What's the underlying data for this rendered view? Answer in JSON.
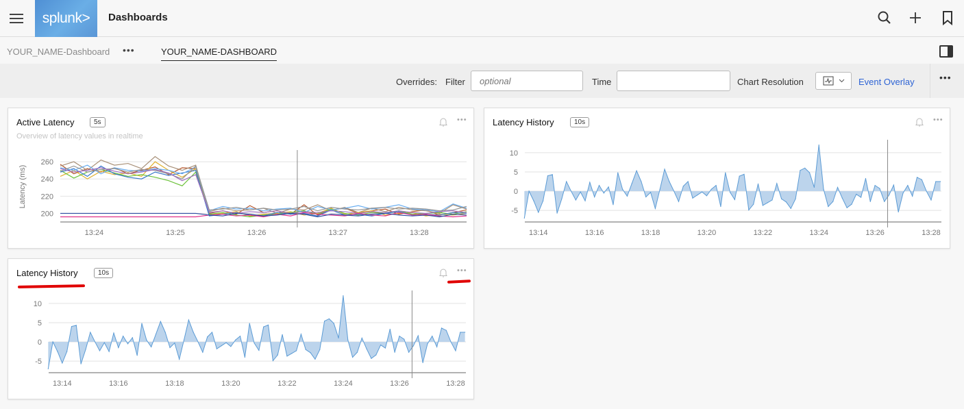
{
  "header": {
    "hamburger_icon": "menu-icon",
    "logo_text": "splunk>",
    "title": "Dashboards",
    "icons": [
      "search-icon",
      "plus-icon",
      "bookmark-icon"
    ]
  },
  "tabs": {
    "group_name": "YOUR_NAME-Dashboard",
    "more_label": "•••",
    "active_tab": "YOUR_NAME-DASHBOARD"
  },
  "toolbar": {
    "overrides_label": "Overrides:",
    "filter_label": "Filter",
    "filter_placeholder": "optional",
    "filter_value": "",
    "time_label": "Time",
    "time_value": "",
    "chart_resolution_label": "Chart Resolution",
    "event_overlay_label": "Event Overlay",
    "more_label": "•••",
    "accent_color": "#2d63d4"
  },
  "panels": [
    {
      "title": "Active Latency",
      "badge": "5s",
      "subtitle": "Overview of latency values in realtime",
      "more_label": "•••"
    },
    {
      "title": "Latency History",
      "badge": "10s",
      "more_label": "•••"
    },
    {
      "title": "Latency History",
      "badge": "10s",
      "more_label": "•••"
    }
  ],
  "chart_data": [
    {
      "type": "line",
      "ylabel": "Latency (ms)",
      "yticks": [
        200,
        220,
        240,
        260
      ],
      "ylim": [
        190,
        272
      ],
      "xticks": [
        "13:24",
        "13:25",
        "13:26",
        "13:27",
        "13:28"
      ],
      "xlim": [
        "13:23:35",
        "13:28:35"
      ],
      "cursor_time": "13:26:30",
      "grid": true,
      "x": [
        "13:23:35",
        "13:23:45",
        "13:23:55",
        "13:24:05",
        "13:24:15",
        "13:24:25",
        "13:24:35",
        "13:24:45",
        "13:24:55",
        "13:25:05",
        "13:25:15",
        "13:25:25",
        "13:25:35",
        "13:25:45",
        "13:25:55",
        "13:26:05",
        "13:26:15",
        "13:26:25",
        "13:26:35",
        "13:26:45",
        "13:26:55",
        "13:27:05",
        "13:27:15",
        "13:27:25",
        "13:27:35",
        "13:27:45",
        "13:27:55",
        "13:28:05",
        "13:28:15",
        "13:28:25",
        "13:28:35"
      ],
      "series": [
        {
          "color": "#b5542a",
          "values": [
            257,
            246,
            252,
            248,
            253,
            246,
            250,
            254,
            245,
            253,
            252,
            200,
            203,
            199,
            209,
            201,
            203,
            199,
            210,
            198,
            204,
            206,
            200,
            203,
            205,
            199,
            202,
            204,
            198,
            201,
            204
          ]
        },
        {
          "color": "#a89078",
          "values": [
            255,
            260,
            250,
            262,
            256,
            258,
            252,
            266,
            255,
            250,
            256,
            202,
            206,
            203,
            204,
            206,
            200,
            205,
            204,
            210,
            203,
            207,
            201,
            206,
            202,
            207,
            204,
            203,
            200,
            210,
            205
          ]
        },
        {
          "color": "#e0b030",
          "values": [
            243,
            250,
            240,
            249,
            245,
            247,
            243,
            260,
            250,
            242,
            252,
            198,
            200,
            202,
            197,
            199,
            200,
            202,
            198,
            200,
            206,
            199,
            201,
            203,
            198,
            200,
            201,
            197,
            199,
            198,
            200
          ]
        },
        {
          "color": "#6cc23a",
          "values": [
            250,
            241,
            248,
            251,
            247,
            243,
            245,
            242,
            238,
            232,
            248,
            199,
            201,
            198,
            196,
            198,
            199,
            201,
            203,
            199,
            205,
            200,
            198,
            201,
            200,
            203,
            199,
            200,
            201,
            199,
            202
          ]
        },
        {
          "color": "#3a78c8",
          "values": [
            248,
            252,
            243,
            255,
            246,
            242,
            240,
            248,
            244,
            247,
            250,
            197,
            199,
            201,
            198,
            197,
            201,
            199,
            200,
            197,
            204,
            198,
            199,
            197,
            200,
            202,
            198,
            199,
            198,
            201,
            200
          ]
        },
        {
          "color": "#6aaef0",
          "values": [
            253,
            250,
            256,
            246,
            253,
            250,
            249,
            252,
            250,
            246,
            254,
            203,
            208,
            205,
            206,
            203,
            205,
            206,
            201,
            208,
            204,
            206,
            209,
            205,
            207,
            210,
            205,
            204,
            202,
            211,
            206
          ]
        },
        {
          "color": "#939393",
          "values": [
            249,
            255,
            248,
            251,
            252,
            248,
            251,
            250,
            246,
            240,
            255,
            204,
            205,
            207,
            204,
            206,
            204,
            205,
            208,
            203,
            207,
            205,
            204,
            206,
            207,
            205,
            206,
            205,
            203,
            204,
            208
          ]
        },
        {
          "color": "#a070c0",
          "values": [
            252,
            248,
            250,
            253,
            249,
            246,
            248,
            251,
            247,
            238,
            245,
            201,
            203,
            200,
            202,
            201,
            203,
            200,
            202,
            201,
            203,
            202,
            200,
            202,
            201,
            203,
            201,
            200,
            202,
            203,
            201
          ]
        },
        {
          "color": "#e0308a",
          "values": [
            196,
            196,
            196,
            196,
            196,
            196,
            196,
            196,
            196,
            196,
            196,
            198,
            199,
            197,
            198,
            196,
            199,
            197,
            201,
            199,
            198,
            197,
            200,
            198,
            197,
            201,
            198,
            199,
            197,
            196,
            197
          ]
        },
        {
          "color": "#2c4aa0",
          "values": [
            200,
            200,
            200,
            200,
            200,
            200,
            200,
            200,
            200,
            200,
            200,
            198,
            197,
            200,
            199,
            197,
            198,
            200,
            199,
            196,
            199,
            198,
            197,
            199,
            200,
            198,
            197,
            198,
            196,
            199,
            198
          ]
        }
      ]
    },
    {
      "type": "area",
      "yticks": [
        -5,
        0,
        5,
        10
      ],
      "ylim": [
        -8,
        13
      ],
      "xticks": [
        "13:14",
        "13:16",
        "13:18",
        "13:20",
        "13:22",
        "13:24",
        "13:26",
        "13:28"
      ],
      "xlim": [
        "13:13:31",
        "13:28:22"
      ],
      "cursor_time": "13:26:27",
      "grid": true,
      "line_color": "#5b9bd5",
      "fill_color": "#bcd4ec",
      "x": [
        "13:13:30",
        "13:13:40",
        "13:13:50",
        "13:14:00",
        "13:14:10",
        "13:14:20",
        "13:14:30",
        "13:14:40",
        "13:14:50",
        "13:15:00",
        "13:15:10",
        "13:15:20",
        "13:15:30",
        "13:15:40",
        "13:15:50",
        "13:16:00",
        "13:16:10",
        "13:16:20",
        "13:16:30",
        "13:16:40",
        "13:16:50",
        "13:17:00",
        "13:17:10",
        "13:17:20",
        "13:17:30",
        "13:17:40",
        "13:17:50",
        "13:18:00",
        "13:18:10",
        "13:18:20",
        "13:18:30",
        "13:18:40",
        "13:18:50",
        "13:19:00",
        "13:19:10",
        "13:19:20",
        "13:19:30",
        "13:19:40",
        "13:19:50",
        "13:20:00",
        "13:20:10",
        "13:20:20",
        "13:20:30",
        "13:20:40",
        "13:20:50",
        "13:21:00",
        "13:21:10",
        "13:21:20",
        "13:21:30",
        "13:21:40",
        "13:21:50",
        "13:22:00",
        "13:22:10",
        "13:22:20",
        "13:22:30",
        "13:22:40",
        "13:22:50",
        "13:23:00",
        "13:23:10",
        "13:23:20",
        "13:23:30",
        "13:23:40",
        "13:23:50",
        "13:24:00",
        "13:24:10",
        "13:24:20",
        "13:24:30",
        "13:24:40",
        "13:24:50",
        "13:25:00",
        "13:25:10",
        "13:25:20",
        "13:25:30",
        "13:25:40",
        "13:25:50",
        "13:26:00",
        "13:26:10",
        "13:26:20",
        "13:26:30",
        "13:26:40",
        "13:26:50",
        "13:27:00",
        "13:27:10",
        "13:27:20",
        "13:27:30",
        "13:27:40",
        "13:27:50",
        "13:28:00",
        "13:28:10",
        "13:28:20"
      ],
      "values": [
        -7,
        0,
        -2.5,
        -5.5,
        -2.5,
        4,
        4.3,
        -5.7,
        -2,
        2.5,
        0,
        -2.3,
        -0.2,
        -2.5,
        2.3,
        -1.5,
        1.5,
        -0.5,
        1.1,
        -3.5,
        4.8,
        0.5,
        -1.3,
        2,
        5.3,
        2.5,
        -1.5,
        -0.3,
        -4.5,
        0.5,
        5.7,
        2.5,
        0,
        -2.7,
        1.3,
        2.5,
        -1.8,
        -1,
        -0.2,
        -1.2,
        0.5,
        1.5,
        -4,
        4.8,
        -0.3,
        -2.2,
        3.9,
        4.4,
        -4.9,
        -3.4,
        1.9,
        -3.7,
        -3,
        -2.3,
        2,
        -2,
        -2.8,
        -4.5,
        -2,
        5.4,
        6,
        4.8,
        1,
        12,
        0.5,
        -4,
        -2.7,
        1,
        -1.8,
        -4.3,
        -3.4,
        -0.8,
        -1.6,
        3.3,
        -2.7,
        1.5,
        0.7,
        -2.7,
        -1,
        1.6,
        -5.4,
        -0.5,
        1.5,
        -1.3,
        3.6,
        3,
        0,
        -2.3,
        2.5,
        2.5
      ]
    }
  ]
}
